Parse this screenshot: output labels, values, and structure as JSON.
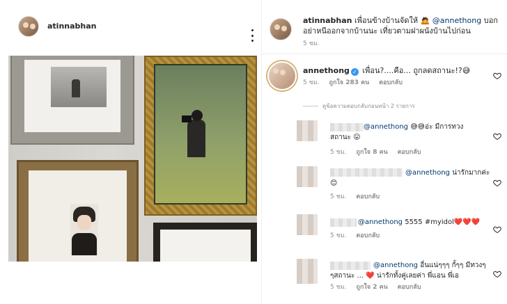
{
  "post": {
    "author": "atinnabhan"
  },
  "caption": {
    "author": "atinnabhan",
    "text_before": "เพื่อนข้างบ้านจัดให้ 🙇 ",
    "mention": "@annethong",
    "text_after": " บอกอย่าหนีออกจากบ้านนะ เที่ยวตามฝาผนังบ้านไปก่อน",
    "time": "5 ชม."
  },
  "main_comment": {
    "author": "annethong",
    "verified_glyph": "✓",
    "text": "เพื่อน?....คือ... ถูกลดสถานะ!?😅",
    "time": "5 ชม.",
    "likes": "ถูกใจ 283 คน",
    "reply_label": "ตอบกลับ"
  },
  "view_replies": {
    "label": "ดูข้อความตอบกลับก่อนหน้า 2 รายการ"
  },
  "replies": [
    {
      "mention": "@annethong",
      "text": " 😅😅อ่ะ มีการทวงสถานะ 😛",
      "time": "5 ชม.",
      "likes": "ถูกใจ 8 คน",
      "reply_label": "ตอบกลับ"
    },
    {
      "mention": "@annethong",
      "text": " น่ารักมากค่ะ 😊",
      "time": "5 ชม.",
      "likes": "",
      "reply_label": "ตอบกลับ"
    },
    {
      "mention": "@annethong",
      "text": " 5555 #myidol❤️❤️❤️",
      "time": "5 ชม.",
      "likes": "",
      "reply_label": "ตอบกลับ"
    },
    {
      "mention": "@annethong",
      "text": " อื่นแน่ๆๆๆ กั้ๆๆ มีทวงๆๆสถานะ ... ❤️ น่ารักทั้งคู่เลยค่า พี่แอน พี่เอ",
      "time": "5 ชม.",
      "likes": "ถูกใจ 2 คน",
      "reply_label": "ตอบกลับ"
    }
  ],
  "icons": {
    "more": "more-dots-icon",
    "heart": "heart-outline-icon"
  },
  "colors": {
    "text": "#262626",
    "muted": "#8e8e8e",
    "mention": "#00376b",
    "verified": "#3897f0",
    "heart_red": "#ed4956"
  }
}
